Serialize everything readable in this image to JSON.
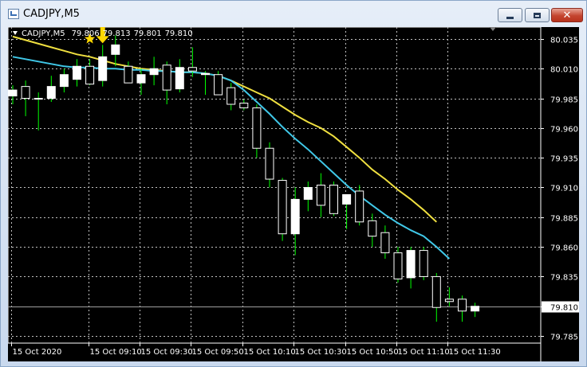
{
  "window": {
    "title": "CADJPY,M5",
    "buttons": {
      "minimize": "minimize",
      "maximize": "maximize",
      "close": "✕"
    }
  },
  "chart_header": {
    "symbol": "CADJPY,M5",
    "open": "79.806",
    "high": "79.813",
    "low": "79.801",
    "close": "79.810"
  },
  "colors": {
    "background": "#000000",
    "grid": "#c0c0c0",
    "bull_fill": "#ffffff",
    "bear_fill": "#000000",
    "candle_outline": "#ffffff",
    "wick": "#00ff00",
    "ma_fast": "#40c8e8",
    "ma_slow": "#f0e040",
    "markers": "#ffd700"
  },
  "chart_data": {
    "type": "candlestick",
    "symbol": "CADJPY",
    "timeframe": "M5",
    "y_ticks": [
      80.035,
      80.01,
      79.985,
      79.96,
      79.935,
      79.91,
      79.885,
      79.86,
      79.835,
      79.81,
      79.785
    ],
    "y_range": [
      79.779,
      80.045
    ],
    "current_price": 79.81,
    "current_price_label": "79.810",
    "x_labels": [
      "15 Oct 2020",
      "15 Oct 09:10",
      "15 Oct 09:30",
      "15 Oct 09:50",
      "15 Oct 10:10",
      "15 Oct 10:30",
      "15 Oct 10:50",
      "15 Oct 11:10",
      "15 Oct 11:30"
    ],
    "x_label_candle_index": [
      0,
      6,
      10,
      14,
      18,
      22,
      26,
      30,
      34
    ],
    "candles": [
      {
        "o": 79.987,
        "h": 79.996,
        "l": 79.98,
        "c": 79.992
      },
      {
        "o": 79.995,
        "h": 80.0,
        "l": 79.97,
        "c": 79.985
      },
      {
        "o": 79.985,
        "h": 79.99,
        "l": 79.958,
        "c": 79.985
      },
      {
        "o": 79.985,
        "h": 80.004,
        "l": 79.982,
        "c": 79.995
      },
      {
        "o": 79.995,
        "h": 80.01,
        "l": 79.99,
        "c": 80.005
      },
      {
        "o": 80.001,
        "h": 80.018,
        "l": 79.995,
        "c": 80.012
      },
      {
        "o": 80.012,
        "h": 80.018,
        "l": 79.996,
        "c": 79.997
      },
      {
        "o": 80.0,
        "h": 80.03,
        "l": 79.995,
        "c": 80.02
      },
      {
        "o": 80.022,
        "h": 80.038,
        "l": 80.012,
        "c": 80.03
      },
      {
        "o": 80.012,
        "h": 80.016,
        "l": 79.998,
        "c": 79.998
      },
      {
        "o": 79.998,
        "h": 80.01,
        "l": 79.988,
        "c": 80.005
      },
      {
        "o": 80.005,
        "h": 80.02,
        "l": 79.996,
        "c": 80.01
      },
      {
        "o": 80.013,
        "h": 80.016,
        "l": 79.98,
        "c": 79.992
      },
      {
        "o": 79.993,
        "h": 80.018,
        "l": 79.99,
        "c": 80.011
      },
      {
        "o": 80.011,
        "h": 80.028,
        "l": 80.003,
        "c": 80.008
      },
      {
        "o": 80.005,
        "h": 80.008,
        "l": 79.988,
        "c": 80.006
      },
      {
        "o": 80.005,
        "h": 80.008,
        "l": 79.995,
        "c": 79.988
      },
      {
        "o": 79.994,
        "h": 79.998,
        "l": 79.975,
        "c": 79.98
      },
      {
        "o": 79.981,
        "h": 79.984,
        "l": 79.975,
        "c": 79.977
      },
      {
        "o": 79.977,
        "h": 79.98,
        "l": 79.935,
        "c": 79.943
      },
      {
        "o": 79.943,
        "h": 79.948,
        "l": 79.91,
        "c": 79.917
      },
      {
        "o": 79.916,
        "h": 79.918,
        "l": 79.865,
        "c": 79.871
      },
      {
        "o": 79.871,
        "h": 79.91,
        "l": 79.853,
        "c": 79.9
      },
      {
        "o": 79.9,
        "h": 79.915,
        "l": 79.89,
        "c": 79.91
      },
      {
        "o": 79.912,
        "h": 79.922,
        "l": 79.885,
        "c": 79.895
      },
      {
        "o": 79.912,
        "h": 79.915,
        "l": 79.886,
        "c": 79.888
      },
      {
        "o": 79.896,
        "h": 79.904,
        "l": 79.875,
        "c": 79.904
      },
      {
        "o": 79.907,
        "h": 79.912,
        "l": 79.878,
        "c": 79.881
      },
      {
        "o": 79.882,
        "h": 79.888,
        "l": 79.86,
        "c": 79.869
      },
      {
        "o": 79.872,
        "h": 79.878,
        "l": 79.85,
        "c": 79.855
      },
      {
        "o": 79.855,
        "h": 79.86,
        "l": 79.83,
        "c": 79.833
      },
      {
        "o": 79.834,
        "h": 79.86,
        "l": 79.825,
        "c": 79.857
      },
      {
        "o": 79.857,
        "h": 79.86,
        "l": 79.832,
        "c": 79.835
      },
      {
        "o": 79.835,
        "h": 79.838,
        "l": 79.797,
        "c": 79.809
      },
      {
        "o": 79.816,
        "h": 79.826,
        "l": 79.81,
        "c": 79.814
      },
      {
        "o": 79.816,
        "h": 79.819,
        "l": 79.797,
        "c": 79.806
      },
      {
        "o": 79.806,
        "h": 79.813,
        "l": 79.801,
        "c": 79.81
      }
    ],
    "ma_fast": [
      80.02,
      80.018,
      80.016,
      80.014,
      80.012,
      80.011,
      80.011,
      80.01,
      80.01,
      80.009,
      80.009,
      80.008,
      80.008,
      80.007,
      80.007,
      80.006,
      80.004,
      80.0,
      79.992,
      79.982,
      79.972,
      79.961,
      79.951,
      79.942,
      79.932,
      79.922,
      79.912,
      79.903,
      79.895,
      79.887,
      79.88,
      79.874,
      79.869,
      79.86,
      79.85
    ],
    "ma_slow": [
      80.037,
      80.034,
      80.031,
      80.028,
      80.025,
      80.022,
      80.02,
      80.017,
      80.014,
      80.012,
      80.01,
      80.009,
      80.008,
      80.007,
      80.007,
      80.006,
      80.004,
      80.0,
      79.995,
      79.99,
      79.985,
      79.978,
      79.971,
      79.965,
      79.96,
      79.953,
      79.944,
      79.935,
      79.925,
      79.917,
      79.908,
      79.9,
      79.891,
      79.881
    ],
    "markers": [
      {
        "type": "star",
        "candle_index": 6,
        "price": 80.035
      },
      {
        "type": "down-arrow",
        "candle_index": 7,
        "price": 80.036
      }
    ]
  }
}
